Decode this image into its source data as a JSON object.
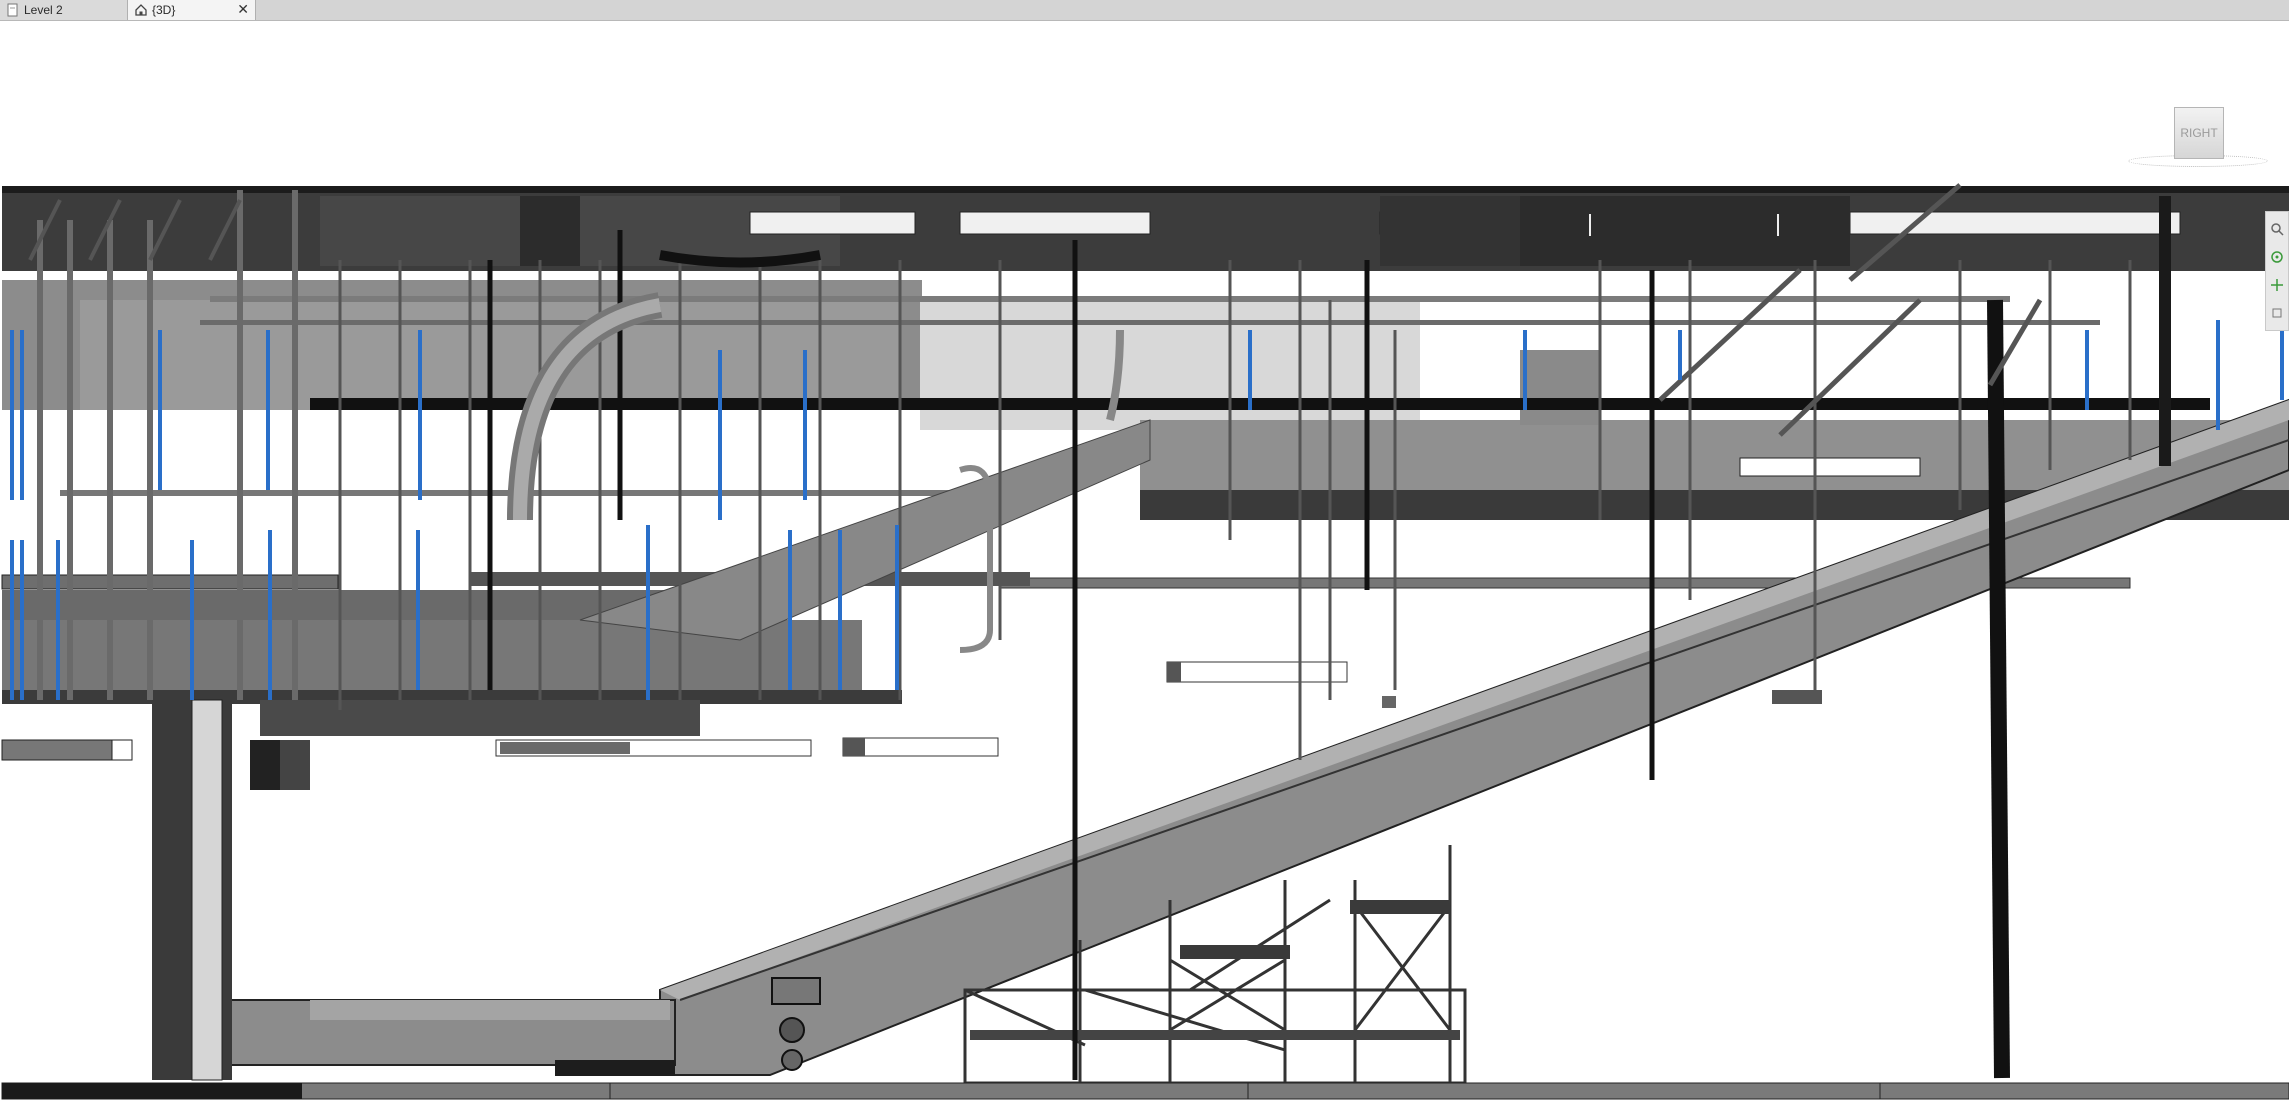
{
  "tabs": [
    {
      "label": "Level 2",
      "active": false,
      "icon": "view-page-icon"
    },
    {
      "label": "{3D}",
      "active": true,
      "icon": "home-3d-icon",
      "closable": true
    }
  ],
  "viewcube": {
    "face_label": "RIGHT"
  },
  "navigation_bar": {
    "buttons": [
      "zoom-icon",
      "steering-wheel-icon",
      "pan-icon",
      "options-icon"
    ]
  },
  "colors": {
    "tab_bar": "#d4d4d4",
    "active_tab": "#f4f4f4",
    "model_dark": "#3c3c3c",
    "model_mid": "#8a8a8a",
    "model_light": "#bdbdbd",
    "hanger_blue": "#2a6fc9",
    "background": "#ffffff"
  }
}
